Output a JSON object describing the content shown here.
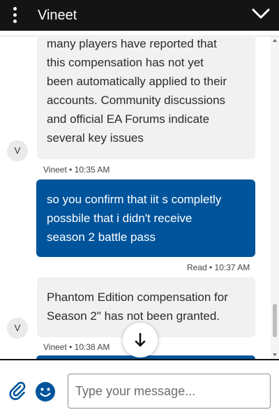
{
  "header": {
    "title": "Vineet"
  },
  "messages": [
    {
      "sender": "agent",
      "avatar": "V",
      "lines": [
        "many players have reported that",
        "this compensation has not yet",
        "been automatically applied to their",
        "accounts. Community discussions",
        "and official EA Forums indicate",
        "several key issues"
      ],
      "meta": "Vineet • 10:35 AM"
    },
    {
      "sender": "user",
      "lines": [
        "so you confirm that iit s completly",
        "possbile that i didn't receive",
        "season 2 battle pass"
      ],
      "meta": "Read • 10:37 AM"
    },
    {
      "sender": "agent",
      "avatar": "V",
      "lines": [
        "Phantom Edition compensation for",
        "Season 2\" has not been granted."
      ],
      "meta": "Vineet • 10:38 AM"
    }
  ],
  "composer": {
    "placeholder": "Type your message..."
  },
  "icons": {
    "menu": "vertical-dots-icon",
    "collapse": "chevron-down-icon",
    "attach": "paperclip-icon",
    "emoji": "smiley-icon",
    "scroll": "arrow-down-icon"
  },
  "colors": {
    "header_bg": "#141414",
    "user_bubble": "#00549b",
    "agent_bubble": "#f1f1f1"
  }
}
